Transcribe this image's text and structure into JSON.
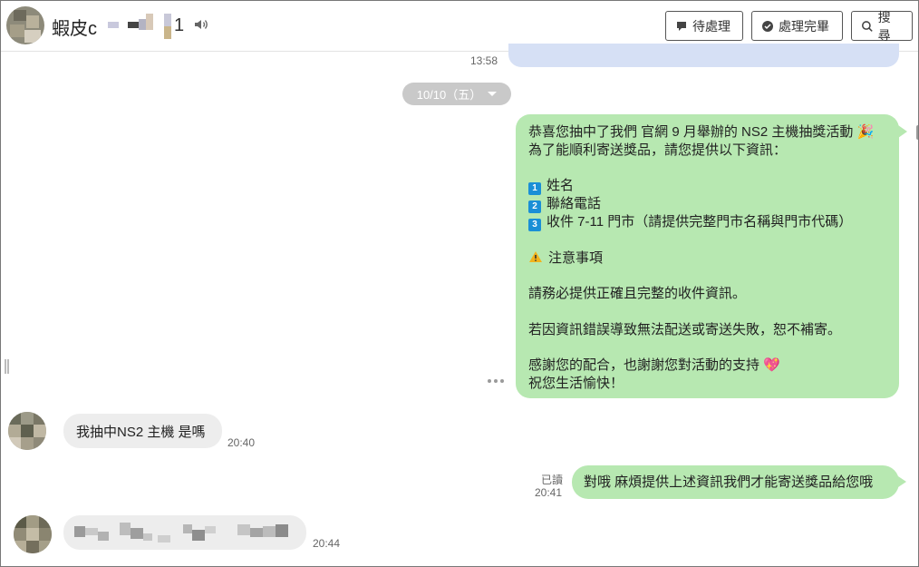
{
  "header": {
    "name_prefix": "蝦皮c",
    "name_suffix": "1",
    "buttons": {
      "pending": "待處理",
      "done": "處理完畢",
      "search": "搜尋"
    }
  },
  "chat": {
    "prev_time": "13:58",
    "date_divider": "10/10（五）",
    "announcement": {
      "lines": [
        "恭喜您抽中了我們 官網 9 月舉辦的 NS2 主機抽獎活動 🎉",
        "為了能順利寄送獎品，請您提供以下資訊：",
        "",
        "姓名",
        "聯絡電話",
        "收件 7-11 門市（請提供完整門市名稱與門市代碼）",
        "",
        "注意事項",
        "",
        "請務必提供正確且完整的收件資訊。",
        "",
        "若因資訊錯誤導致無法配送或寄送失敗，恕不補寄。",
        "",
        "感謝您的配合，也謝謝您對活動的支持 💖",
        "祝您生活愉快！"
      ],
      "numbers": [
        "1",
        "2",
        "3"
      ]
    },
    "customer_message_1": {
      "text": "我抽中NS2 主機 是嗎",
      "time": "20:40"
    },
    "reply": {
      "read": "已讀",
      "time": "20:41",
      "text": "對哦 麻煩提供上述資訊我們才能寄送獎品給您哦"
    },
    "customer_message_2": {
      "time": "20:44"
    }
  },
  "colors": {
    "sent_bubble": "#b7e8b1",
    "received_bubble": "#ededed",
    "date_pill": "#c9c9c9",
    "number_badge": "#1a8fd6"
  }
}
